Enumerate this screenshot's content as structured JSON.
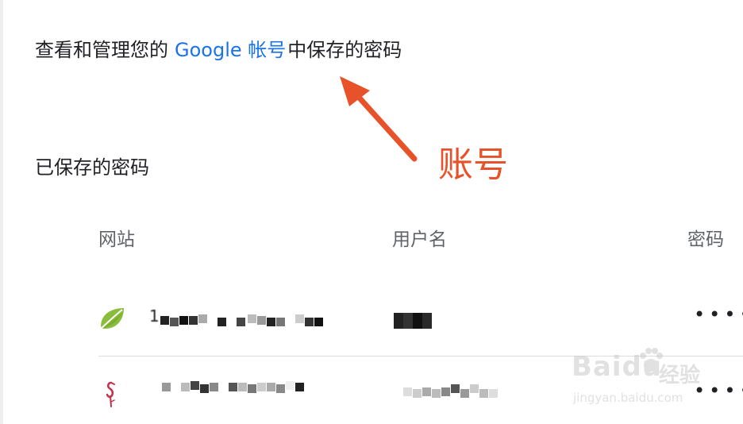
{
  "intro": {
    "before": "查看和管理您的",
    "link": "Google 帐号",
    "after": "中保存的密码"
  },
  "section_title": "已保存的密码",
  "columns": {
    "site": "网站",
    "username": "用户名",
    "password": "密码"
  },
  "rows": [
    {
      "icon": "leaf-icon",
      "site_visible": "1",
      "password_mask": "••••"
    },
    {
      "icon": "flamingo-icon",
      "site_visible": "",
      "password_mask": "••••"
    }
  ],
  "annotation": {
    "label": "账号",
    "color": "#e8522b"
  },
  "watermark": {
    "brand": "Baidu",
    "cn": "经验",
    "url": "jingyan.baidu.com"
  },
  "colors": {
    "link": "#1a73e8",
    "text": "#202124",
    "header": "#5f6368",
    "divider": "#dadce0"
  }
}
